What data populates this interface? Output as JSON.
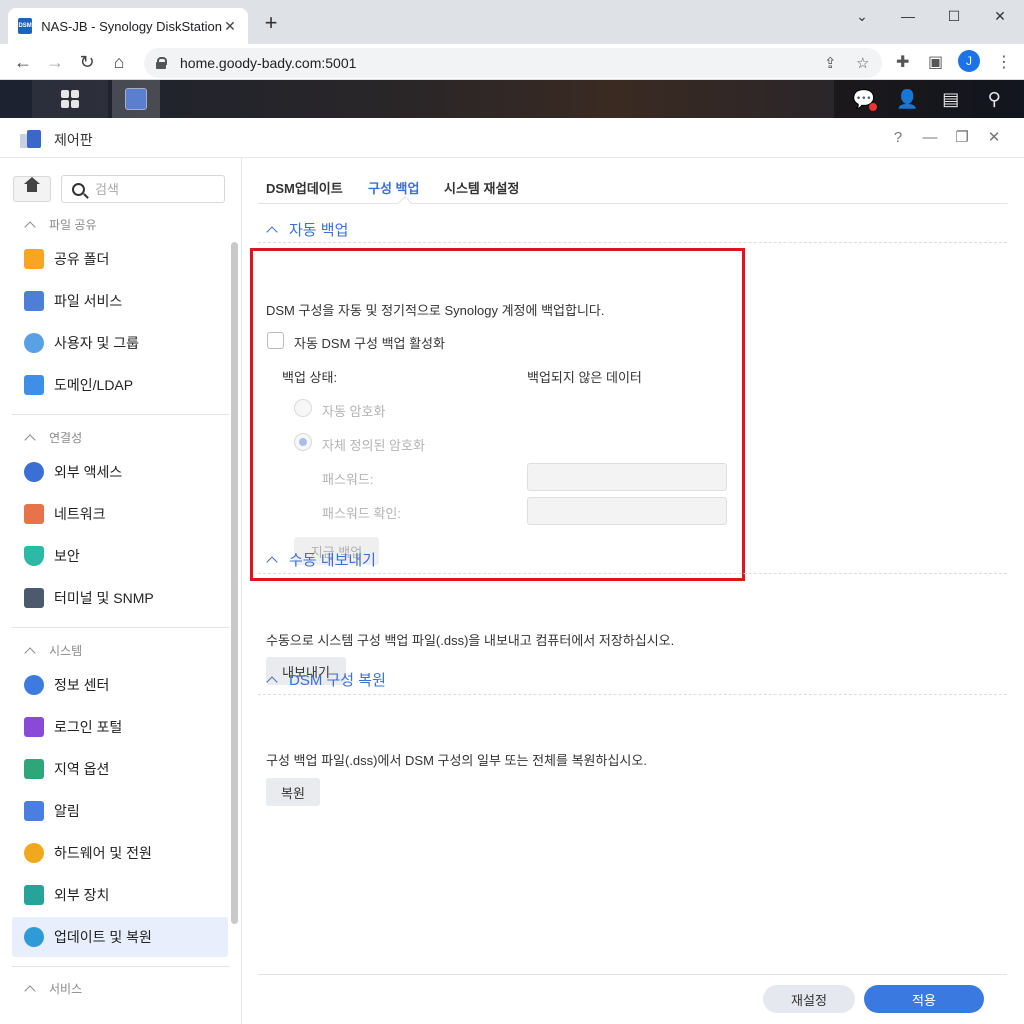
{
  "browser": {
    "tab_title": "NAS-JB - Synology DiskStation",
    "favicon_text": "DSM",
    "url": "home.goody-bady.com:5001",
    "profile_initial": "J"
  },
  "window": {
    "title": "제어판",
    "help": "?"
  },
  "sidebar": {
    "search_placeholder": "검색",
    "sections": [
      {
        "label": "파일 공유"
      },
      {
        "label": "연결성"
      },
      {
        "label": "시스템"
      },
      {
        "label": "서비스"
      }
    ],
    "items": [
      {
        "label": "공유 폴더",
        "icon": "shared-folder-icon"
      },
      {
        "label": "파일 서비스",
        "icon": "file-services-icon"
      },
      {
        "label": "사용자 및 그룹",
        "icon": "user-group-icon"
      },
      {
        "label": "도메인/LDAP",
        "icon": "domain-ldap-icon"
      },
      {
        "label": "외부 액세스",
        "icon": "external-access-icon"
      },
      {
        "label": "네트워크",
        "icon": "network-icon"
      },
      {
        "label": "보안",
        "icon": "security-shield-icon"
      },
      {
        "label": "터미널 및 SNMP",
        "icon": "terminal-icon"
      },
      {
        "label": "정보 센터",
        "icon": "info-center-icon"
      },
      {
        "label": "로그인 포털",
        "icon": "login-portal-icon"
      },
      {
        "label": "지역 옵션",
        "icon": "regional-options-icon"
      },
      {
        "label": "알림",
        "icon": "notification-icon"
      },
      {
        "label": "하드웨어 및 전원",
        "icon": "hardware-power-icon"
      },
      {
        "label": "외부 장치",
        "icon": "external-device-icon"
      },
      {
        "label": "업데이트 및 복원",
        "icon": "update-restore-icon",
        "active": true
      }
    ]
  },
  "tabs": [
    "DSM업데이트",
    "구성 백업",
    "시스템 재설정"
  ],
  "auto_backup": {
    "title": "자동 백업",
    "description": "DSM 구성을 자동 및 정기적으로 Synology 계정에 백업합니다.",
    "enable_label": "자동 DSM 구성 백업 활성화",
    "status_label": "백업 상태:",
    "status_value": "백업되지 않은 데이터",
    "radio_auto": "자동 암호화",
    "radio_custom": "자체 정의된 암호화",
    "password_label": "패스워드:",
    "password_confirm_label": "패스워드 확인:",
    "backup_now": "지금 백업"
  },
  "manual_export": {
    "title": "수동 내보내기",
    "description": "수동으로 시스템 구성 백업 파일(.dss)을 내보내고 컴퓨터에서 저장하십시오.",
    "button": "내보내기"
  },
  "restore": {
    "title": "DSM 구성 복원",
    "description": "구성 백업 파일(.dss)에서 DSM 구성의 일부 또는 전체를 복원하십시오.",
    "button": "복원"
  },
  "footer": {
    "reset": "재설정",
    "apply": "적용"
  },
  "colors": {
    "accent": "#3a6fd8",
    "highlight_box": "#e0141e",
    "apply_button": "#3a7ae0"
  }
}
